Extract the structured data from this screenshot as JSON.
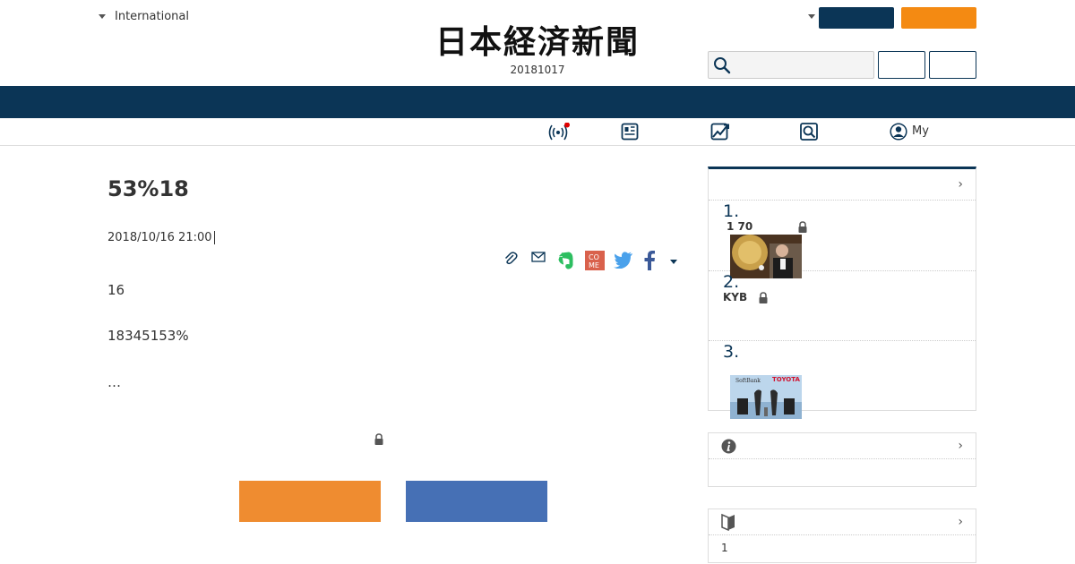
{
  "header": {
    "region_label": "International",
    "logo_text": "日本経済新聞",
    "date_text": "20181017",
    "search_placeholder": "",
    "my_label": "My"
  },
  "article": {
    "headline": "53%18",
    "published": "2018/10/16 21:00",
    "paragraphs": [
      "16",
      "18345153%",
      "…"
    ]
  },
  "ranking": {
    "items": [
      {
        "num": "1.",
        "title": "1 70"
      },
      {
        "num": "2.",
        "title": "KYB"
      },
      {
        "num": "3.",
        "title": ""
      }
    ],
    "thumb3_left_label": "SoftBank",
    "thumb3_right_label": "TOYOTA"
  },
  "beginner": {
    "text": "1"
  },
  "colors": {
    "navy": "#0b3556",
    "orange": "#f48a12",
    "cta_orange": "#ef8c30",
    "cta_blue": "#4670b5",
    "alert_dot": "#e00000"
  }
}
